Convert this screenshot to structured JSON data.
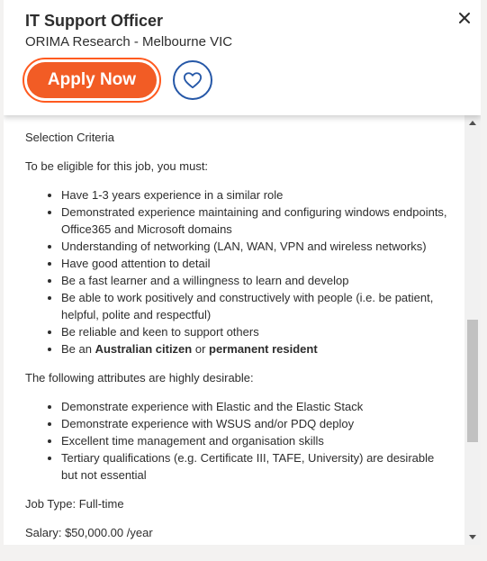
{
  "header": {
    "job_title": "IT Support Officer",
    "company_location": "ORIMA Research - Melbourne VIC",
    "apply_label": "Apply Now",
    "close_icon": "close-icon",
    "save_icon": "heart-icon"
  },
  "colors": {
    "apply_bg": "#f25c25",
    "apply_ring": "#ff5a1f",
    "save_ring": "#2557a7",
    "text": "#2d2d2d"
  },
  "description": {
    "criteria_heading": "Selection Criteria",
    "eligibility_intro": "To be eligible for this job, you must:",
    "requirements": [
      "Have 1-3 years experience in a similar role",
      "Demonstrated experience maintaining and configuring windows endpoints, Office365 and Microsoft domains",
      "Understanding of networking (LAN, WAN, VPN and wireless networks)",
      "Have good attention to detail",
      "Be a fast learner and a willingness to learn and develop",
      "Be able to work positively and constructively with people (i.e. be patient, helpful, polite and respectful)",
      "Be reliable and keen to support others"
    ],
    "citizenship": {
      "prefix": "Be an ",
      "bold1": "Australian citizen",
      "middle": " or ",
      "bold2": "permanent resident"
    },
    "desirable_intro": "The following attributes are highly desirable:",
    "desirable": [
      "Demonstrate experience with Elastic and the Elastic Stack",
      "Demonstrate experience with WSUS and/or PDQ deploy",
      "Excellent time management and organisation skills",
      "Tertiary qualifications (e.g. Certificate III, TAFE, University) are desirable but not essential"
    ],
    "job_type": "Job Type: Full-time",
    "salary": "Salary: $50,000.00 /year"
  }
}
